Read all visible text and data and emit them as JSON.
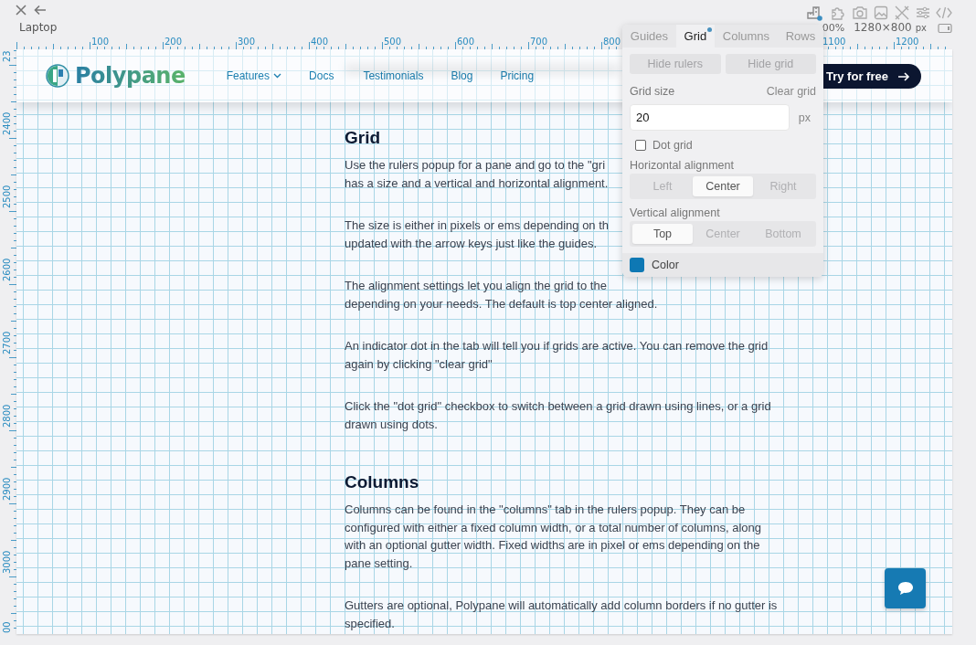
{
  "toolbar": {
    "device_label": "Laptop",
    "zoom": "00%",
    "resolution": "1280×800",
    "resolution_unit": "px"
  },
  "rulers": {
    "top_labels": [
      "100",
      "200",
      "300",
      "400",
      "500",
      "600",
      "700",
      "800",
      "1100",
      "1200"
    ],
    "left_labels": [
      "23",
      "2400",
      "2500",
      "2600",
      "2700",
      "2800",
      "2900",
      "3000",
      "00"
    ]
  },
  "site": {
    "logo": "Polypane",
    "nav": [
      {
        "label": "Features",
        "dropdown": true
      },
      {
        "label": "Docs",
        "dropdown": false
      },
      {
        "label": "Testimonials",
        "dropdown": false
      },
      {
        "label": "Blog",
        "dropdown": false
      },
      {
        "label": "Pricing",
        "dropdown": false
      }
    ],
    "cta": "Try for free"
  },
  "article": [
    {
      "kind": "heading",
      "text": "Grid"
    },
    {
      "kind": "paragraph",
      "lines": [
        "Use the rulers popup for a pane and go to the \"gri",
        "has a size and a vertical and horizontal alignment."
      ]
    },
    {
      "kind": "paragraph",
      "lines": [
        "The size is either in pixels or ems depending on th",
        "updated with the arrow keys just like the guides."
      ]
    },
    {
      "kind": "paragraph",
      "lines": [
        "The alignment settings let you align the grid to the",
        "depending on your needs. The default is top center aligned."
      ]
    },
    {
      "kind": "paragraph",
      "lines": [
        "An indicator dot in the tab will tell you if grids are active. You can remove the grid",
        "again by clicking \"clear grid\""
      ]
    },
    {
      "kind": "paragraph",
      "lines": [
        "Click the \"dot grid\" checkbox to switch between a grid drawn using lines, or a grid",
        "drawn using dots."
      ]
    },
    {
      "kind": "heading",
      "text": "Columns"
    },
    {
      "kind": "paragraph",
      "lines": [
        "Columns can be found in the \"columns\" tab in the rulers popup. They can be",
        "configured with either a fixed column width, or a total number of columns, along",
        "with an optional gutter width. Fixed widths are in pixel or ems depending on the",
        "pane setting."
      ]
    },
    {
      "kind": "paragraph",
      "lines": [
        "Gutters are optional, Polypane will automatically add column borders if no gutter is",
        "specified."
      ]
    }
  ],
  "rulers_popup": {
    "tabs": [
      {
        "label": "Guides",
        "selected": false,
        "indicator": false
      },
      {
        "label": "Grid",
        "selected": true,
        "indicator": true
      },
      {
        "label": "Columns",
        "selected": false,
        "indicator": false
      },
      {
        "label": "Rows",
        "selected": false,
        "indicator": false
      }
    ],
    "buttons": [
      "Hide rulers",
      "Hide grid"
    ],
    "grid_size_label": "Grid size",
    "clear_link": "Clear grid",
    "grid_size": {
      "value": "20",
      "unit": "px"
    },
    "dot_grid": {
      "label": "Dot grid",
      "checked": false
    },
    "horizontal_alignment": {
      "label": "Horizontal alignment",
      "options": [
        {
          "label": "Left",
          "selected": false
        },
        {
          "label": "Center",
          "selected": true
        },
        {
          "label": "Right",
          "selected": false
        }
      ]
    },
    "vertical_alignment": {
      "label": "Vertical alignment",
      "options": [
        {
          "label": "Top",
          "selected": true
        },
        {
          "label": "Center",
          "selected": false
        },
        {
          "label": "Bottom",
          "selected": false
        }
      ]
    },
    "grid_color": {
      "label": "Color",
      "color": "#0e78b4"
    }
  }
}
